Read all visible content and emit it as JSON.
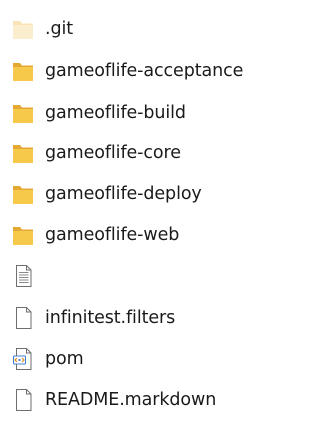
{
  "window": {
    "title": ""
  },
  "colors": {
    "folder": "#f6c94a",
    "folder_dark": "#e4a935",
    "hidden_folder": "#f8e4b6",
    "text": "#1a1a1a"
  },
  "file_list": {
    "items": [
      {
        "name": ".git",
        "kind": "folder",
        "icon": "hidden-folder-icon"
      },
      {
        "name": "gameoflife-acceptance",
        "kind": "folder",
        "icon": "folder-icon"
      },
      {
        "name": "gameoflife-build",
        "kind": "folder",
        "icon": "folder-icon"
      },
      {
        "name": "gameoflife-core",
        "kind": "folder",
        "icon": "folder-icon"
      },
      {
        "name": "gameoflife-deploy",
        "kind": "folder",
        "icon": "folder-icon"
      },
      {
        "name": "gameoflife-web",
        "kind": "folder",
        "icon": "folder-icon"
      },
      {
        "name": "",
        "kind": "file",
        "icon": "text-document-icon"
      },
      {
        "name": "infinitest.filters",
        "kind": "file",
        "icon": "blank-file-icon"
      },
      {
        "name": "pom",
        "kind": "file",
        "icon": "xml-file-icon"
      },
      {
        "name": "README.markdown",
        "kind": "file",
        "icon": "blank-file-icon"
      }
    ]
  }
}
